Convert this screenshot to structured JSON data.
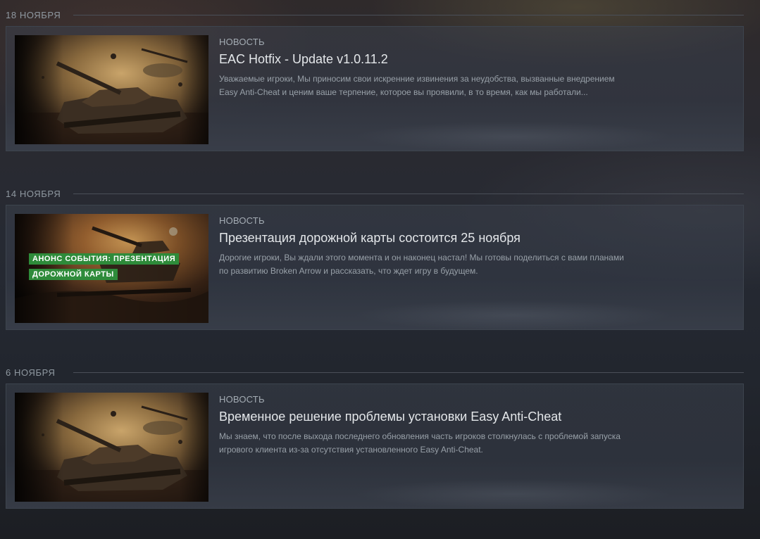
{
  "news_groups": [
    {
      "date": "18 НОЯБРЯ",
      "card": {
        "tag": "НОВОСТЬ",
        "title": "EAC Hotfix - Update v1.0.11.2",
        "description": "Уважаемые игроки, Мы приносим свои искренние извинения за неудобства, вызванные внедрением Easy Anti-Cheat и ценим ваше терпение, которое вы проявили, в то время, как мы работали..."
      }
    },
    {
      "date": "14 НОЯБРЯ",
      "card": {
        "tag": "НОВОСТЬ",
        "title": "Презентация дорожной карты состоится 25 ноября",
        "description": "Дорогие игроки, Вы ждали этого момента и он наконец настал! Мы готовы поделиться с вами планами по развитию Broken Arrow и рассказать, что ждет игру в будущем.",
        "thumb_badge_line1": "АНОНС СОБЫТИЯ: ПРЕЗЕНТАЦИЯ",
        "thumb_badge_line2": "ДОРОЖНОЙ КАРТЫ"
      }
    },
    {
      "date": "6 НОЯБРЯ",
      "card": {
        "tag": "НОВОСТЬ",
        "title": "Временное решение проблемы установки Easy Anti-Cheat",
        "description": "Мы знаем, что после выхода последнего обновления часть игроков столкнулась с проблемой запуска игрового клиента из-за отсутствия установленного Easy Anti-Cheat."
      }
    }
  ],
  "colors": {
    "badge_green": "#2e8b3a",
    "title_text": "#e4e7ea",
    "muted_text": "#98a0a8"
  }
}
